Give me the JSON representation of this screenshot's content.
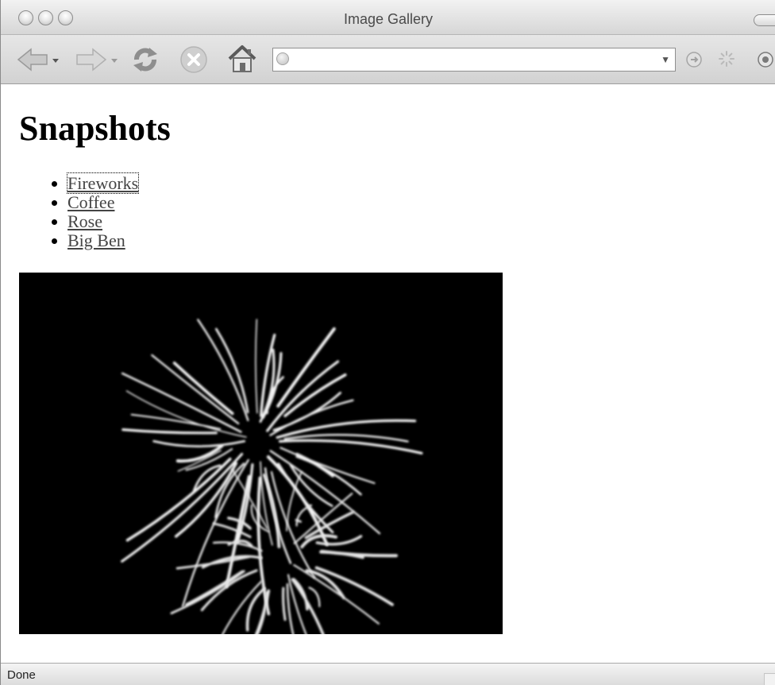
{
  "window": {
    "title": "Image Gallery"
  },
  "toolbar": {
    "back_icon": "back-arrow-icon",
    "forward_icon": "forward-arrow-icon",
    "reload_icon": "reload-icon",
    "stop_icon": "stop-icon",
    "home_icon": "home-icon",
    "url_value": "",
    "go_icon": "go-icon",
    "spinner_icon": "spinner-icon",
    "search_icon": "search-engine-icon"
  },
  "page": {
    "heading": "Snapshots",
    "links": [
      {
        "label": "Fireworks"
      },
      {
        "label": "Coffee"
      },
      {
        "label": "Rose"
      },
      {
        "label": "Big Ben"
      }
    ],
    "image_subject": "fireworks"
  },
  "status": {
    "text": "Done"
  }
}
